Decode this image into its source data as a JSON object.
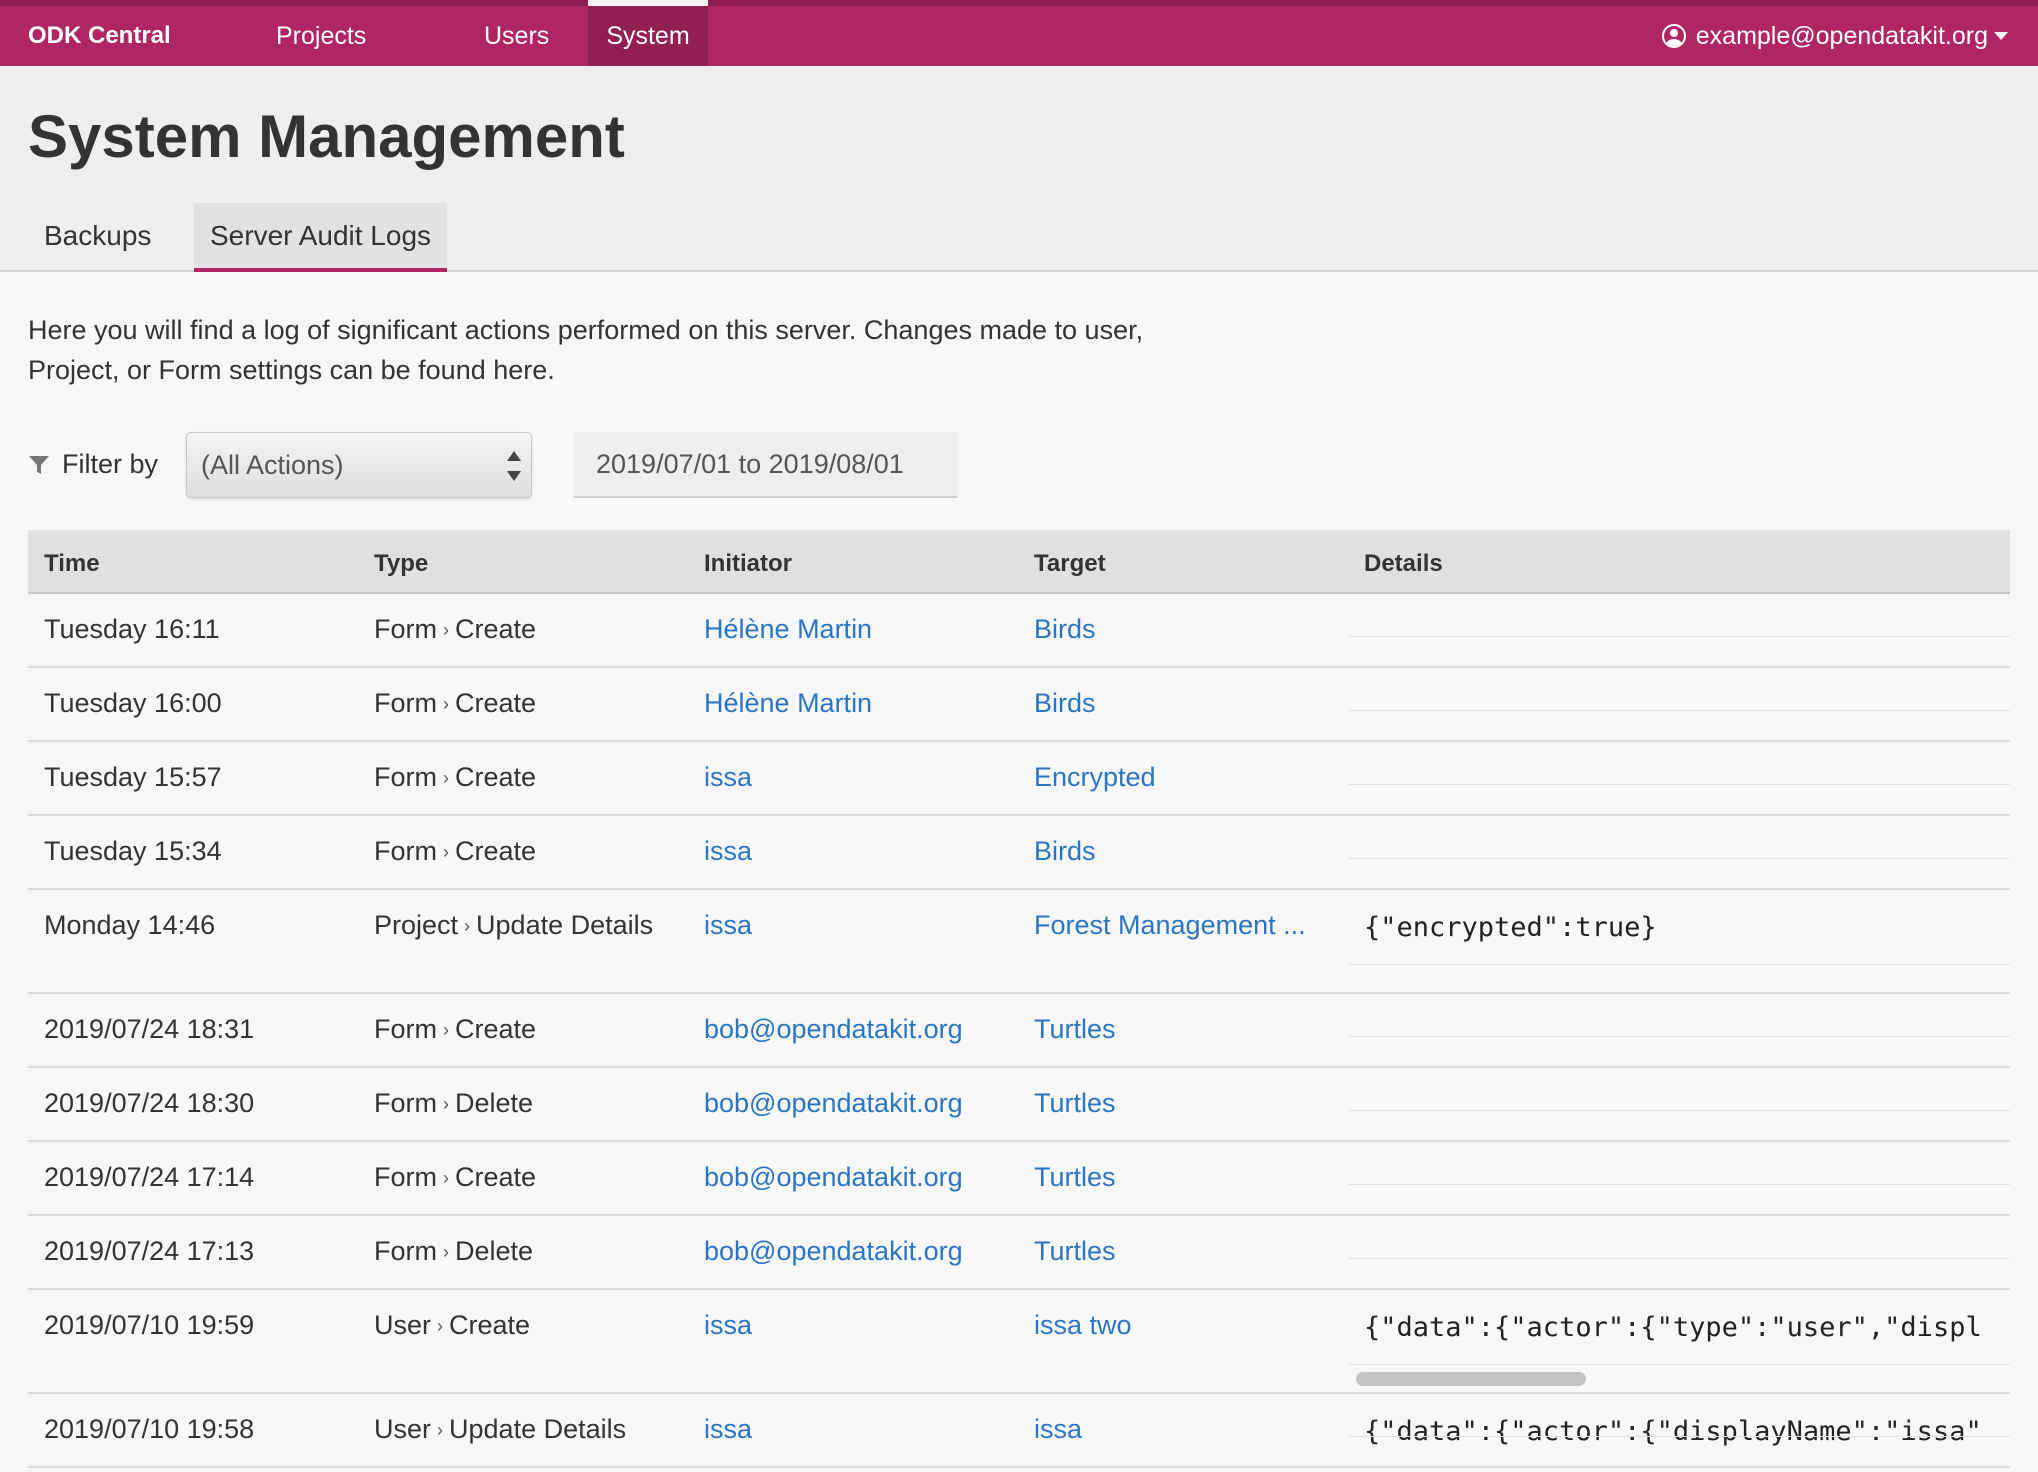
{
  "nav": {
    "brand": "ODK Central",
    "items": [
      {
        "label": "Projects"
      },
      {
        "label": "Users"
      },
      {
        "label": "System"
      }
    ],
    "account": "example@opendatakit.org"
  },
  "page": {
    "title": "System Management",
    "tabs": [
      {
        "label": "Backups",
        "active": false
      },
      {
        "label": "Server Audit Logs",
        "active": true
      }
    ]
  },
  "intro": {
    "line1": "Here you will find a log of significant actions performed on this server. Changes made to user,",
    "line2": "Project, or Form settings can be found here."
  },
  "filters": {
    "label": "Filter by",
    "action_value": "(All Actions)",
    "date_range": "2019/07/01 to 2019/08/01"
  },
  "table": {
    "headers": {
      "time": "Time",
      "type": "Type",
      "initiator": "Initiator",
      "target": "Target",
      "details": "Details"
    },
    "type_separator": "›",
    "rows": [
      {
        "time": "Tuesday 16:11",
        "type_a": "Form",
        "type_b": "Create",
        "initiator": "Hélène Martin",
        "target": "Birds",
        "details": ""
      },
      {
        "time": "Tuesday 16:00",
        "type_a": "Form",
        "type_b": "Create",
        "initiator": "Hélène Martin",
        "target": "Birds",
        "details": ""
      },
      {
        "time": "Tuesday 15:57",
        "type_a": "Form",
        "type_b": "Create",
        "initiator": "issa",
        "target": "Encrypted",
        "details": ""
      },
      {
        "time": "Tuesday 15:34",
        "type_a": "Form",
        "type_b": "Create",
        "initiator": "issa",
        "target": "Birds",
        "details": ""
      },
      {
        "time": "Monday 14:46",
        "type_a": "Project",
        "type_b": "Update Details",
        "initiator": "issa",
        "target": "Forest Management ...",
        "details": "{\"encrypted\":true}"
      },
      {
        "time": "2019/07/24 18:31",
        "type_a": "Form",
        "type_b": "Create",
        "initiator": "bob@opendatakit.org",
        "target": "Turtles",
        "details": ""
      },
      {
        "time": "2019/07/24 18:30",
        "type_a": "Form",
        "type_b": "Delete",
        "initiator": "bob@opendatakit.org",
        "target": "Turtles",
        "details": ""
      },
      {
        "time": "2019/07/24 17:14",
        "type_a": "Form",
        "type_b": "Create",
        "initiator": "bob@opendatakit.org",
        "target": "Turtles",
        "details": ""
      },
      {
        "time": "2019/07/24 17:13",
        "type_a": "Form",
        "type_b": "Delete",
        "initiator": "bob@opendatakit.org",
        "target": "Turtles",
        "details": ""
      },
      {
        "time": "2019/07/10 19:59",
        "type_a": "User",
        "type_b": "Create",
        "initiator": "issa",
        "target": "issa two",
        "details": "{\"data\":{\"actor\":{\"type\":\"user\",\"displ"
      },
      {
        "time": "2019/07/10 19:58",
        "type_a": "User",
        "type_b": "Update Details",
        "initiator": "issa",
        "target": "issa",
        "details": "{\"data\":{\"actor\":{\"displayName\":\"issa\""
      }
    ]
  },
  "colors": {
    "navbar": "#b02665",
    "link": "#2a76c4",
    "active_tab_border": "#b02665"
  }
}
